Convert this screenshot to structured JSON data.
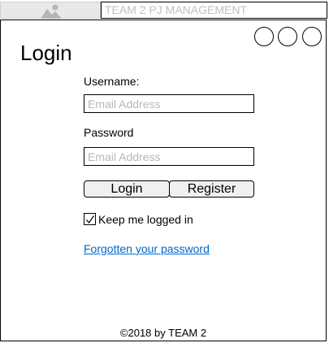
{
  "header": {
    "image_icon": "image-placeholder-icon",
    "title": "TEAM 2 PJ MANAGEMENT"
  },
  "window": {
    "controls": [
      "circle",
      "circle",
      "circle"
    ]
  },
  "login": {
    "heading": "Login",
    "username_label": "Username:",
    "username_placeholder": "Email Address",
    "password_label": "Password",
    "password_placeholder": "Email Address",
    "login_button": "Login",
    "register_button": "Register",
    "remember_label": "Keep me logged in",
    "remember_checked": true,
    "forgot_link": "Forgotten your password"
  },
  "footer": {
    "text": "©2018 by TEAM 2"
  },
  "colors": {
    "link": "#0066cc",
    "placeholder": "#b8b8b8",
    "button_bg": "#f0f0f0"
  }
}
